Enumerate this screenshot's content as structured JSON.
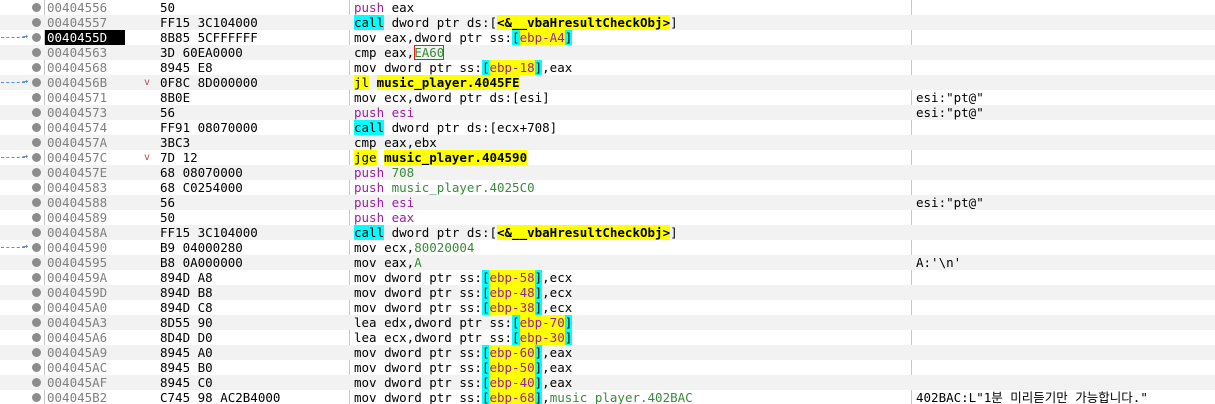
{
  "current_address": "0040455D",
  "rows": [
    {
      "addr": "00404556",
      "bytes": "50",
      "tokens": [
        [
          "push",
          "pur"
        ],
        [
          " eax",
          ""
        ]
      ],
      "comment": ""
    },
    {
      "addr": "00404557",
      "bytes": "FF15 3C104000",
      "tokens": [
        [
          "call",
          "hl-c"
        ],
        [
          " dword ptr ds:[",
          ""
        ],
        [
          "<&__vbaHresultCheckObj>",
          "hl-y-b"
        ],
        [
          "]",
          ""
        ]
      ],
      "comment": ""
    },
    {
      "addr": "0040455D",
      "bytes": "8B85 5CFFFFFF",
      "arrow": true,
      "current": true,
      "tokens": [
        [
          "mov eax,dword ptr ss:",
          ""
        ],
        [
          "[",
          "hl-c"
        ],
        [
          "ebp-A4",
          "pur hl-y"
        ],
        [
          "]",
          "hl-c"
        ]
      ],
      "comment": ""
    },
    {
      "addr": "00404563",
      "bytes": "3D 60EA0000",
      "tokens": [
        [
          "cmp eax,",
          ""
        ],
        [
          "EA60",
          "grn box-red"
        ]
      ],
      "comment": ""
    },
    {
      "addr": "00404568",
      "bytes": "8945 E8",
      "tokens": [
        [
          "mov dword ptr ss:",
          ""
        ],
        [
          "[",
          "hl-c"
        ],
        [
          "ebp-18",
          "pur hl-y"
        ],
        [
          "]",
          "hl-c"
        ],
        [
          ",eax",
          ""
        ]
      ],
      "comment": ""
    },
    {
      "addr": "0040456B",
      "bytes": "0F8C 8D000000",
      "mark": "v",
      "arrow": true,
      "tokens": [
        [
          "jl",
          "hl-y"
        ],
        [
          " ",
          ""
        ],
        [
          "music_player.4045FE",
          "hl-y-b"
        ]
      ],
      "comment": ""
    },
    {
      "addr": "00404571",
      "bytes": "8B0E",
      "tokens": [
        [
          "mov ecx,dword ptr ds:[esi]",
          ""
        ]
      ],
      "comment": "esi:\"pt@\""
    },
    {
      "addr": "00404573",
      "bytes": "56",
      "tokens": [
        [
          "push",
          "pur"
        ],
        [
          " esi",
          "pur"
        ]
      ],
      "comment": "esi:\"pt@\""
    },
    {
      "addr": "00404574",
      "bytes": "FF91 08070000",
      "tokens": [
        [
          "call",
          "hl-c"
        ],
        [
          " dword ptr ds:[ecx+708]",
          ""
        ]
      ],
      "comment": ""
    },
    {
      "addr": "0040457A",
      "bytes": "3BC3",
      "tokens": [
        [
          "cmp eax,ebx",
          ""
        ]
      ],
      "comment": ""
    },
    {
      "addr": "0040457C",
      "bytes": "7D 12",
      "mark": "v",
      "arrow": true,
      "tokens": [
        [
          "jge",
          "hl-y"
        ],
        [
          " ",
          ""
        ],
        [
          "music_player.404590",
          "hl-y-b"
        ]
      ],
      "comment": ""
    },
    {
      "addr": "0040457E",
      "bytes": "68 08070000",
      "tokens": [
        [
          "push",
          "pur"
        ],
        [
          " 708",
          "grn"
        ]
      ],
      "comment": ""
    },
    {
      "addr": "00404583",
      "bytes": "68 C0254000",
      "tokens": [
        [
          "push",
          "pur"
        ],
        [
          " music_player.4025C0",
          "grn"
        ]
      ],
      "comment": ""
    },
    {
      "addr": "00404588",
      "bytes": "56",
      "tokens": [
        [
          "push",
          "pur"
        ],
        [
          " esi",
          "pur"
        ]
      ],
      "comment": "esi:\"pt@\""
    },
    {
      "addr": "00404589",
      "bytes": "50",
      "tokens": [
        [
          "push",
          "pur"
        ],
        [
          " eax",
          "pur"
        ]
      ],
      "comment": ""
    },
    {
      "addr": "0040458A",
      "bytes": "FF15 3C104000",
      "tokens": [
        [
          "call",
          "hl-c"
        ],
        [
          " dword ptr ds:[",
          ""
        ],
        [
          "<&__vbaHresultCheckObj>",
          "hl-y-b"
        ],
        [
          "]",
          ""
        ]
      ],
      "comment": ""
    },
    {
      "addr": "00404590",
      "bytes": "B9 04000280",
      "arrow": true,
      "tokens": [
        [
          "mov ecx,",
          ""
        ],
        [
          "80020004",
          "grn"
        ]
      ],
      "comment": ""
    },
    {
      "addr": "00404595",
      "bytes": "B8 0A000000",
      "tokens": [
        [
          "mov eax,",
          ""
        ],
        [
          "A",
          "grn"
        ]
      ],
      "comment": "A:'\\n'"
    },
    {
      "addr": "0040459A",
      "bytes": "894D A8",
      "tokens": [
        [
          "mov dword ptr ss:",
          ""
        ],
        [
          "[",
          "hl-c"
        ],
        [
          "ebp-58",
          "pur hl-y"
        ],
        [
          "]",
          "hl-c"
        ],
        [
          ",ecx",
          ""
        ]
      ],
      "comment": ""
    },
    {
      "addr": "0040459D",
      "bytes": "894D B8",
      "tokens": [
        [
          "mov dword ptr ss:",
          ""
        ],
        [
          "[",
          "hl-c"
        ],
        [
          "ebp-48",
          "pur hl-y"
        ],
        [
          "]",
          "hl-c"
        ],
        [
          ",ecx",
          ""
        ]
      ],
      "comment": ""
    },
    {
      "addr": "004045A0",
      "bytes": "894D C8",
      "tokens": [
        [
          "mov dword ptr ss:",
          ""
        ],
        [
          "[",
          "hl-c"
        ],
        [
          "ebp-38",
          "pur hl-y"
        ],
        [
          "]",
          "hl-c"
        ],
        [
          ",ecx",
          ""
        ]
      ],
      "comment": ""
    },
    {
      "addr": "004045A3",
      "bytes": "8D55 90",
      "tokens": [
        [
          "lea edx,dword ptr ss:",
          ""
        ],
        [
          "[",
          "hl-c"
        ],
        [
          "ebp-70",
          "pur hl-y"
        ],
        [
          "]",
          "hl-c"
        ]
      ],
      "comment": ""
    },
    {
      "addr": "004045A6",
      "bytes": "8D4D D0",
      "tokens": [
        [
          "lea ecx,dword ptr ss:",
          ""
        ],
        [
          "[",
          "hl-c"
        ],
        [
          "ebp-30",
          "pur hl-y"
        ],
        [
          "]",
          "hl-c"
        ]
      ],
      "comment": ""
    },
    {
      "addr": "004045A9",
      "bytes": "8945 A0",
      "tokens": [
        [
          "mov dword ptr ss:",
          ""
        ],
        [
          "[",
          "hl-c"
        ],
        [
          "ebp-60",
          "pur hl-y"
        ],
        [
          "]",
          "hl-c"
        ],
        [
          ",eax",
          ""
        ]
      ],
      "comment": ""
    },
    {
      "addr": "004045AC",
      "bytes": "8945 B0",
      "tokens": [
        [
          "mov dword ptr ss:",
          ""
        ],
        [
          "[",
          "hl-c"
        ],
        [
          "ebp-50",
          "pur hl-y"
        ],
        [
          "]",
          "hl-c"
        ],
        [
          ",eax",
          ""
        ]
      ],
      "comment": ""
    },
    {
      "addr": "004045AF",
      "bytes": "8945 C0",
      "tokens": [
        [
          "mov dword ptr ss:",
          ""
        ],
        [
          "[",
          "hl-c"
        ],
        [
          "ebp-40",
          "pur hl-y"
        ],
        [
          "]",
          "hl-c"
        ],
        [
          ",eax",
          ""
        ]
      ],
      "comment": ""
    },
    {
      "addr": "004045B2",
      "bytes": "C745 98 AC2B4000",
      "tokens": [
        [
          "mov dword ptr ss:",
          ""
        ],
        [
          "[",
          "hl-c"
        ],
        [
          "ebp-68",
          "pur hl-y"
        ],
        [
          "]",
          "hl-c"
        ],
        [
          ",",
          ""
        ],
        [
          "music_player.402BAC",
          "grn"
        ]
      ],
      "comment": "402BAC:L\"1분 미리듣기만 가능합니다.\""
    }
  ]
}
